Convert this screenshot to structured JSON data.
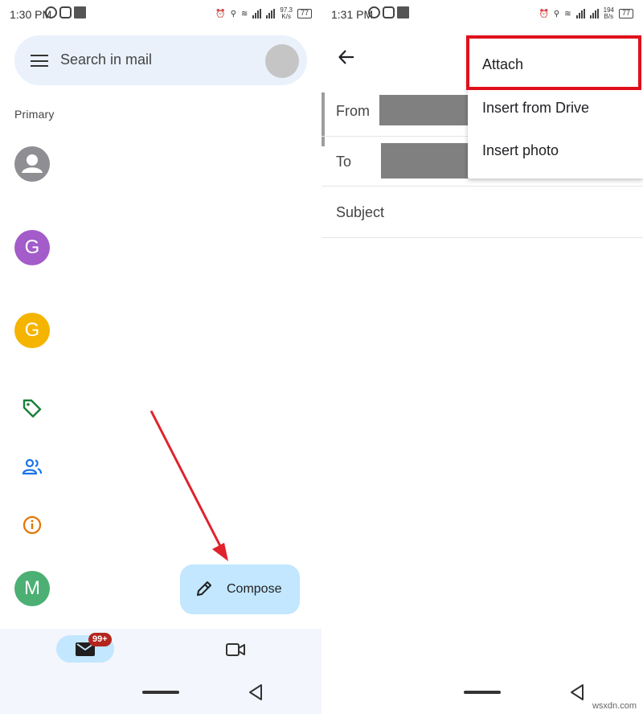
{
  "left": {
    "status": {
      "time": "1:30 PM",
      "speed": "97.3",
      "speed_unit": "K/s",
      "battery": "77"
    },
    "search": {
      "placeholder": "Search in mail"
    },
    "section_label": "Primary",
    "rows": [
      {
        "avatar": "",
        "color": "#8e8e93"
      },
      {
        "avatar": "G",
        "color": "#a35cc9"
      },
      {
        "avatar": "G",
        "color": "#f5b400"
      },
      {
        "icon": "tag-icon",
        "color": "#188038"
      },
      {
        "icon": "people-icon",
        "color": "#1a73e8"
      },
      {
        "icon": "info-icon",
        "color": "#e37400"
      },
      {
        "avatar": "M",
        "color": "#4caf73"
      }
    ],
    "compose_label": "Compose",
    "nav": {
      "mail_badge": "99+"
    }
  },
  "right": {
    "status": {
      "time": "1:31 PM",
      "speed": "194",
      "speed_unit": "B/s",
      "battery": "77"
    },
    "fields": {
      "from": "From",
      "to": "To",
      "subject": "Subject"
    },
    "menu": {
      "attach": "Attach",
      "drive": "Insert from Drive",
      "photo": "Insert photo"
    }
  },
  "colors": {
    "accent_blue": "#c2e7ff",
    "search_bg": "#eaf1fb",
    "highlight_red": "#e0101b",
    "badge_red": "#b3261e"
  },
  "watermark": "wsxdn.com"
}
